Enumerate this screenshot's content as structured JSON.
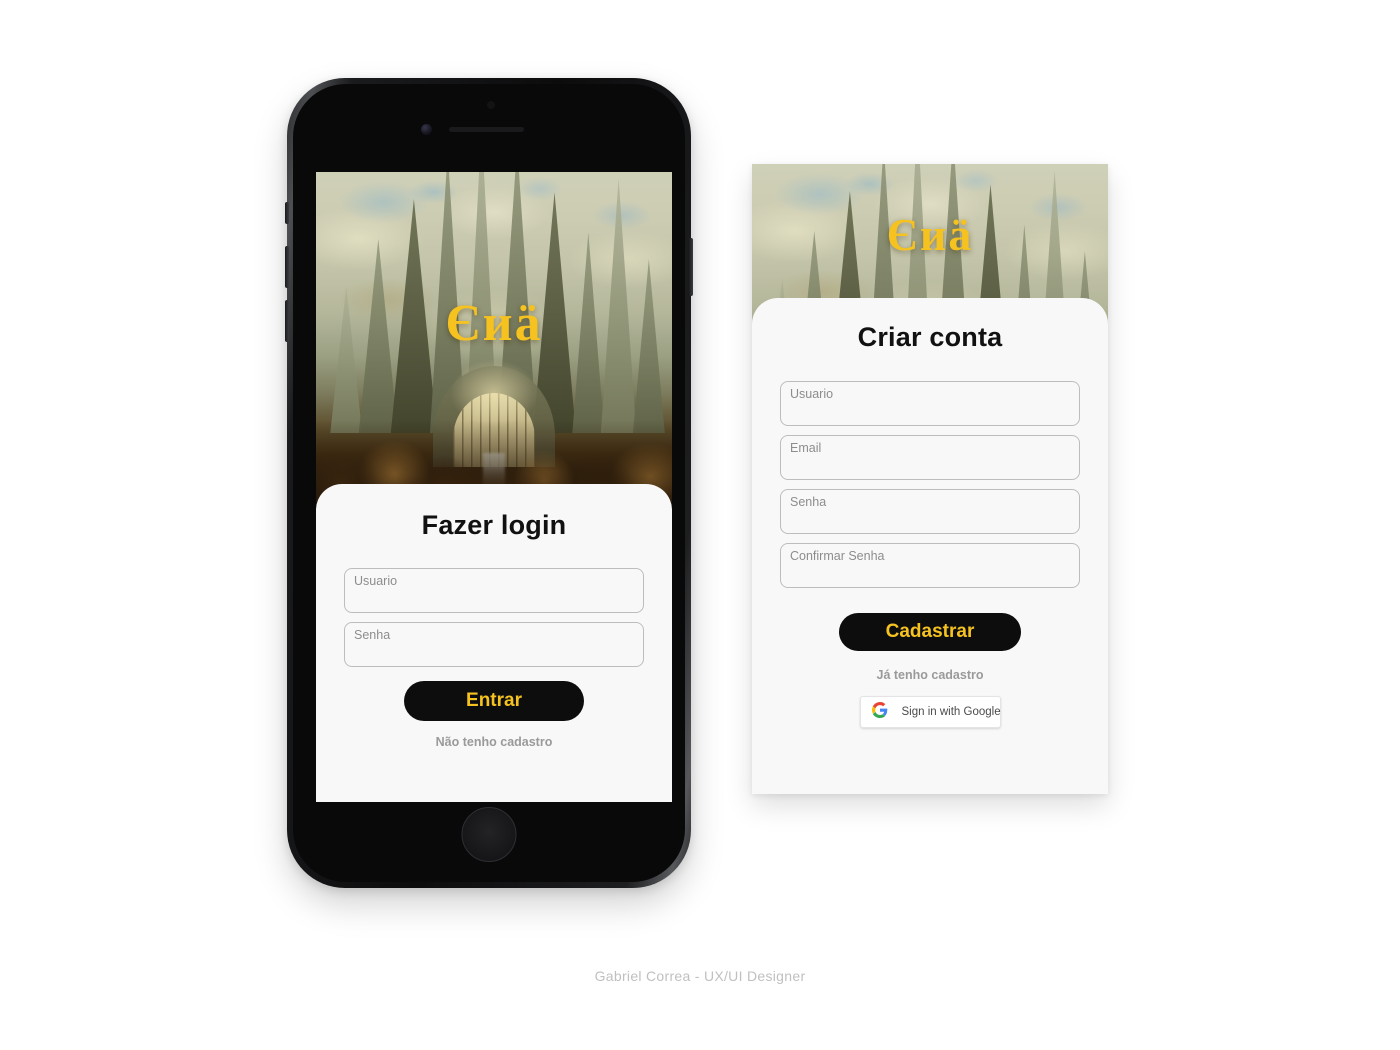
{
  "page": {
    "background_color": "#ffffff",
    "credit": "Gabriel Correa - UX/UI Designer"
  },
  "brand": {
    "logo_text": "Єиӓ",
    "gold": "#f5c220",
    "button_black": "#0d0d0d",
    "card_background": "#f8f8f8"
  },
  "login_screen": {
    "device": "iphone-mockup",
    "logo_text": "Єиӓ",
    "title": "Fazer login",
    "fields": [
      {
        "label": "Usuario",
        "value": "",
        "placeholder": ""
      },
      {
        "label": "Senha",
        "value": "",
        "placeholder": ""
      }
    ],
    "submit_label": "Entrar",
    "switch_link": "Não tenho cadastro"
  },
  "signup_screen": {
    "logo_text": "Єиӓ",
    "title": "Criar conta",
    "fields": [
      {
        "label": "Usuario",
        "value": "",
        "placeholder": ""
      },
      {
        "label": "Email",
        "value": "",
        "placeholder": ""
      },
      {
        "label": "Senha",
        "value": "",
        "placeholder": ""
      },
      {
        "label": "Confirmar Senha",
        "value": "",
        "placeholder": ""
      }
    ],
    "submit_label": "Cadastrar",
    "switch_link": "Já tenho cadastro",
    "google_button_label": "Sign in with Google"
  }
}
